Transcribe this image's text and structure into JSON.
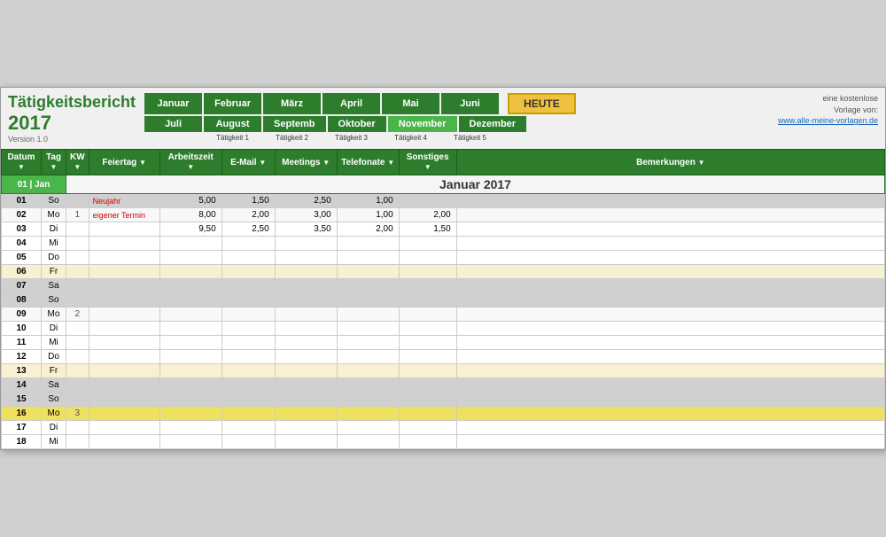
{
  "header": {
    "title": "Tätigkeitsbericht",
    "year": "2017",
    "version": "Version 1.0",
    "heute_label": "HEUTE",
    "info_line1": "eine kostenlose",
    "info_line2": "Vorlage von:",
    "info_link": "www.alle-meine-vorlagen.de"
  },
  "months_row1": [
    "Januar",
    "Februar",
    "März",
    "April",
    "Mai",
    "Juni"
  ],
  "months_row2": [
    "Juli",
    "August",
    "Septemb",
    "Oktober",
    "November",
    "Dezember"
  ],
  "taetigkeiten_sub": [
    "Tätigkeit 1",
    "Tätigkeit 2",
    "Tätigkeit 3",
    "Tätigkeit 4",
    "Tätigkeit 5"
  ],
  "table_headers": [
    "Datum",
    "Tag",
    "KW",
    "Feiertag",
    "Arbeitszeit",
    "E-Mail",
    "Meetings",
    "Telefonate",
    "Sonstiges",
    "Bemerkungen"
  ],
  "month_title": "Januar 2017",
  "group_header": "01 | Jan",
  "rows": [
    {
      "date": "01",
      "day": "So",
      "kw": "",
      "feiertag": "Neujahr",
      "feiertag_type": "holiday",
      "arbeitszeit": "5,00",
      "email": "1,50",
      "meetings": "2,50",
      "telefonate": "1,00",
      "sonstiges": "",
      "bemerkungen": "",
      "row_type": "weekend"
    },
    {
      "date": "02",
      "day": "Mo",
      "kw": "1",
      "feiertag": "eigener Termin",
      "feiertag_type": "appt",
      "arbeitszeit": "8,00",
      "email": "2,00",
      "meetings": "3,00",
      "telefonate": "1,00",
      "sonstiges": "2,00",
      "bemerkungen": "",
      "row_type": "weekday"
    },
    {
      "date": "03",
      "day": "Di",
      "kw": "",
      "feiertag": "",
      "feiertag_type": "",
      "arbeitszeit": "9,50",
      "email": "2,50",
      "meetings": "3,50",
      "telefonate": "2,00",
      "sonstiges": "1,50",
      "bemerkungen": "",
      "row_type": "weekday"
    },
    {
      "date": "04",
      "day": "Mi",
      "kw": "",
      "feiertag": "",
      "feiertag_type": "",
      "arbeitszeit": "",
      "email": "",
      "meetings": "",
      "telefonate": "",
      "sonstiges": "",
      "bemerkungen": "",
      "row_type": "weekday"
    },
    {
      "date": "05",
      "day": "Do",
      "kw": "",
      "feiertag": "",
      "feiertag_type": "",
      "arbeitszeit": "",
      "email": "",
      "meetings": "",
      "telefonate": "",
      "sonstiges": "",
      "bemerkungen": "",
      "row_type": "weekday"
    },
    {
      "date": "06",
      "day": "Fr",
      "kw": "",
      "feiertag": "",
      "feiertag_type": "",
      "arbeitszeit": "",
      "email": "",
      "meetings": "",
      "telefonate": "",
      "sonstiges": "",
      "bemerkungen": "",
      "row_type": "friday"
    },
    {
      "date": "07",
      "day": "Sa",
      "kw": "",
      "feiertag": "",
      "feiertag_type": "",
      "arbeitszeit": "",
      "email": "",
      "meetings": "",
      "telefonate": "",
      "sonstiges": "",
      "bemerkungen": "",
      "row_type": "saturday"
    },
    {
      "date": "08",
      "day": "So",
      "kw": "",
      "feiertag": "",
      "feiertag_type": "",
      "arbeitszeit": "",
      "email": "",
      "meetings": "",
      "telefonate": "",
      "sonstiges": "",
      "bemerkungen": "",
      "row_type": "sunday"
    },
    {
      "date": "09",
      "day": "Mo",
      "kw": "2",
      "feiertag": "",
      "feiertag_type": "",
      "arbeitszeit": "",
      "email": "",
      "meetings": "",
      "telefonate": "",
      "sonstiges": "",
      "bemerkungen": "",
      "row_type": "weekday"
    },
    {
      "date": "10",
      "day": "Di",
      "kw": "",
      "feiertag": "",
      "feiertag_type": "",
      "arbeitszeit": "",
      "email": "",
      "meetings": "",
      "telefonate": "",
      "sonstiges": "",
      "bemerkungen": "",
      "row_type": "weekday"
    },
    {
      "date": "11",
      "day": "Mi",
      "kw": "",
      "feiertag": "",
      "feiertag_type": "",
      "arbeitszeit": "",
      "email": "",
      "meetings": "",
      "telefonate": "",
      "sonstiges": "",
      "bemerkungen": "",
      "row_type": "weekday"
    },
    {
      "date": "12",
      "day": "Do",
      "kw": "",
      "feiertag": "",
      "feiertag_type": "",
      "arbeitszeit": "",
      "email": "",
      "meetings": "",
      "telefonate": "",
      "sonstiges": "",
      "bemerkungen": "",
      "row_type": "weekday"
    },
    {
      "date": "13",
      "day": "Fr",
      "kw": "",
      "feiertag": "",
      "feiertag_type": "",
      "arbeitszeit": "",
      "email": "",
      "meetings": "",
      "telefonate": "",
      "sonstiges": "",
      "bemerkungen": "",
      "row_type": "friday"
    },
    {
      "date": "14",
      "day": "Sa",
      "kw": "",
      "feiertag": "",
      "feiertag_type": "",
      "arbeitszeit": "",
      "email": "",
      "meetings": "",
      "telefonate": "",
      "sonstiges": "",
      "bemerkungen": "",
      "row_type": "saturday"
    },
    {
      "date": "15",
      "day": "So",
      "kw": "",
      "feiertag": "",
      "feiertag_type": "",
      "arbeitszeit": "",
      "email": "",
      "meetings": "",
      "telefonate": "",
      "sonstiges": "",
      "bemerkungen": "",
      "row_type": "sunday"
    },
    {
      "date": "16",
      "day": "Mo",
      "kw": "3",
      "feiertag": "",
      "feiertag_type": "",
      "arbeitszeit": "",
      "email": "",
      "meetings": "",
      "telefonate": "",
      "sonstiges": "",
      "bemerkungen": "",
      "row_type": "highlight"
    },
    {
      "date": "17",
      "day": "Di",
      "kw": "",
      "feiertag": "",
      "feiertag_type": "",
      "arbeitszeit": "",
      "email": "",
      "meetings": "",
      "telefonate": "",
      "sonstiges": "",
      "bemerkungen": "",
      "row_type": "weekday"
    },
    {
      "date": "18",
      "day": "Mi",
      "kw": "",
      "feiertag": "",
      "feiertag_type": "",
      "arbeitszeit": "",
      "email": "",
      "meetings": "",
      "telefonate": "",
      "sonstiges": "",
      "bemerkungen": "",
      "row_type": "weekday"
    }
  ]
}
